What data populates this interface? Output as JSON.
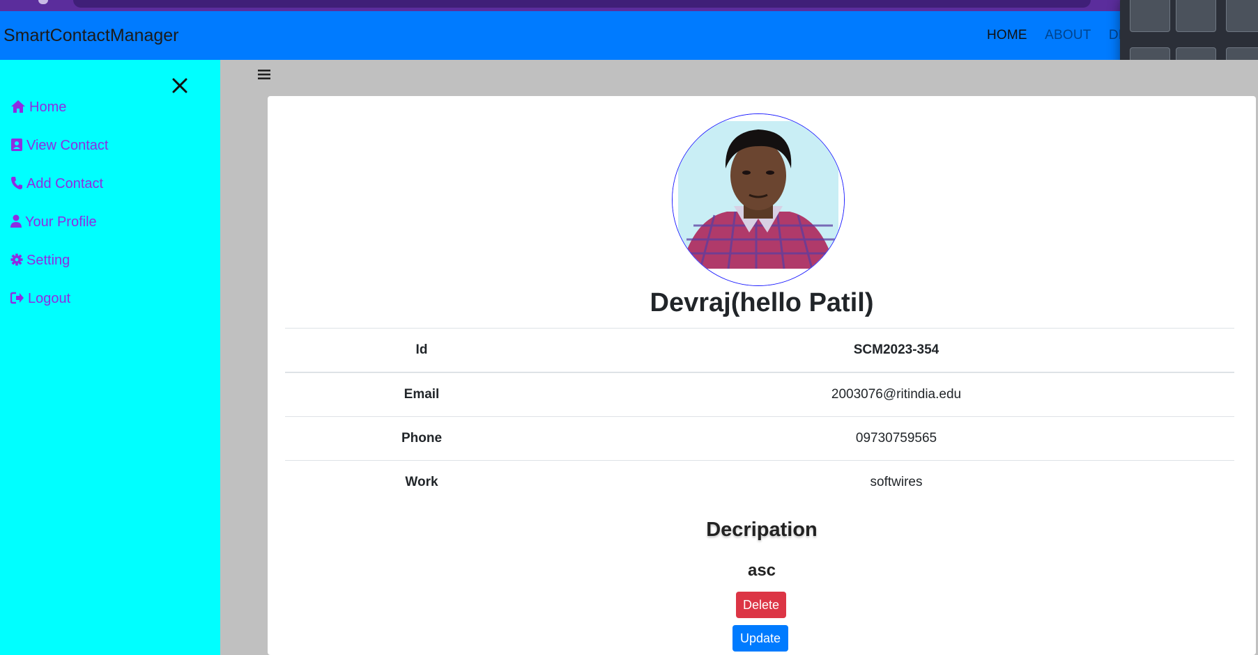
{
  "navbar": {
    "brand": "SmartContactManager",
    "links": {
      "home": "HOME",
      "about": "ABOUT",
      "dev": "DEV"
    }
  },
  "sidebar": {
    "items": [
      {
        "label": "Home",
        "icon": "home-icon"
      },
      {
        "label": "View Contact",
        "icon": "address-card-icon"
      },
      {
        "label": "Add Contact",
        "icon": "phone-icon"
      },
      {
        "label": "Your Profile",
        "icon": "user-icon"
      },
      {
        "label": "Setting",
        "icon": "gear-icon"
      },
      {
        "label": "Logout",
        "icon": "sign-out-icon"
      }
    ]
  },
  "contact": {
    "name": "Devraj(hello Patil)",
    "rows": [
      {
        "key": "Id",
        "value": "SCM2023-354"
      },
      {
        "key": "Email",
        "value": "2003076@ritindia.edu"
      },
      {
        "key": "Phone",
        "value": "09730759565"
      },
      {
        "key": "Work",
        "value": "softwires"
      }
    ],
    "description_title": "Decripation",
    "description": "asc"
  },
  "actions": {
    "delete": "Delete",
    "update": "Update"
  },
  "colors": {
    "navbar": "#007bff",
    "sidebar": "#00ffff",
    "sidebar_text": "#8e2de2",
    "delete": "#dc3545",
    "update": "#007bff",
    "main_bg": "#c0c0c0"
  }
}
